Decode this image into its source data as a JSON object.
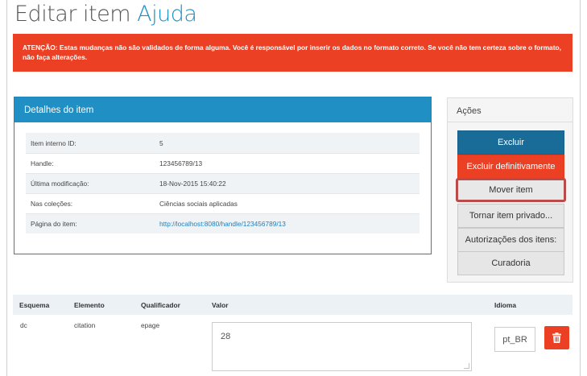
{
  "title": {
    "prefix": "Editar item",
    "accent": "Ajuda"
  },
  "alert": "ATENÇÃO: Estas mudanças não são validados de forma alguma. Você é responsável por inserir os dados no formato correto. Se você não tem certeza sobre o formato, não faça alterações.",
  "details": {
    "heading": "Detalhes do item",
    "rows": [
      {
        "label": "Item interno ID:",
        "value": "5"
      },
      {
        "label": "Handle:",
        "value": "123456789/13"
      },
      {
        "label": "Última modificação:",
        "value": "18-Nov-2015 15:40:22"
      },
      {
        "label": "Nas coleções:",
        "value": "Ciências sociais aplicadas"
      },
      {
        "label": "Página do item:",
        "value": "http://localhost:8080/handle/123456789/13"
      }
    ]
  },
  "actions": {
    "heading": "Ações",
    "delete": "Excluir",
    "expunge": "Excluir definitivamente",
    "move": "Mover item",
    "make_private": "Tornar item privado...",
    "authorizations": "Autorizações dos itens:",
    "curation": "Curadoria"
  },
  "metadata": {
    "headers": {
      "schema": "Esquema",
      "element": "Elemento",
      "qualifier": "Qualificador",
      "value": "Valor",
      "language": "Idioma"
    },
    "rows": [
      {
        "schema": "dc",
        "element": "citation",
        "qualifier": "epage",
        "value": "28",
        "language": "pt_BR"
      }
    ]
  },
  "icons": {
    "delete_row": "trash-icon"
  },
  "colors": {
    "accent": "#1f8fc4",
    "danger": "#ec4024",
    "primary": "#1a6c98"
  }
}
